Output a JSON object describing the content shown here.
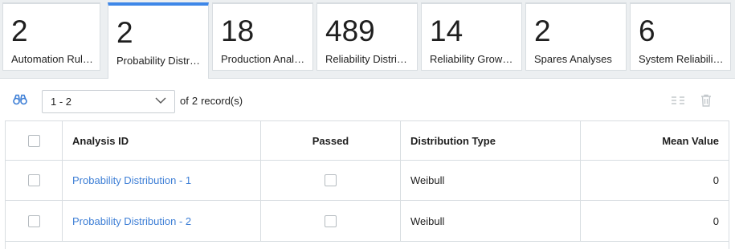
{
  "tiles": [
    {
      "count": "2",
      "label": "Automation Rul…"
    },
    {
      "count": "2",
      "label": "Probability Distr…"
    },
    {
      "count": "18",
      "label": "Production Anal…"
    },
    {
      "count": "489",
      "label": "Reliability Distri…"
    },
    {
      "count": "14",
      "label": "Reliability Growt…"
    },
    {
      "count": "2",
      "label": "Spares Analyses"
    },
    {
      "count": "6",
      "label": "System Reliabilit…"
    }
  ],
  "active_tile": 1,
  "toolbar": {
    "find_icon": "binoculars-icon",
    "range_value": "1 - 2",
    "of_label": "of",
    "record_count": "2",
    "records_label": "record(s)",
    "columns_icon": "column-chooser-icon",
    "delete_icon": "trash-icon"
  },
  "table": {
    "headers": [
      "Analysis ID",
      "Passed",
      "Distribution Type",
      "Mean Value"
    ],
    "rows": [
      {
        "analysis_id": "Probability Distribution - 1",
        "passed": false,
        "distribution_type": "Weibull",
        "mean_value": "0"
      },
      {
        "analysis_id": "Probability Distribution - 2",
        "passed": false,
        "distribution_type": "Weibull",
        "mean_value": "0"
      }
    ]
  },
  "colors": {
    "accent": "#3e87e8",
    "link": "#3e7fd6"
  }
}
